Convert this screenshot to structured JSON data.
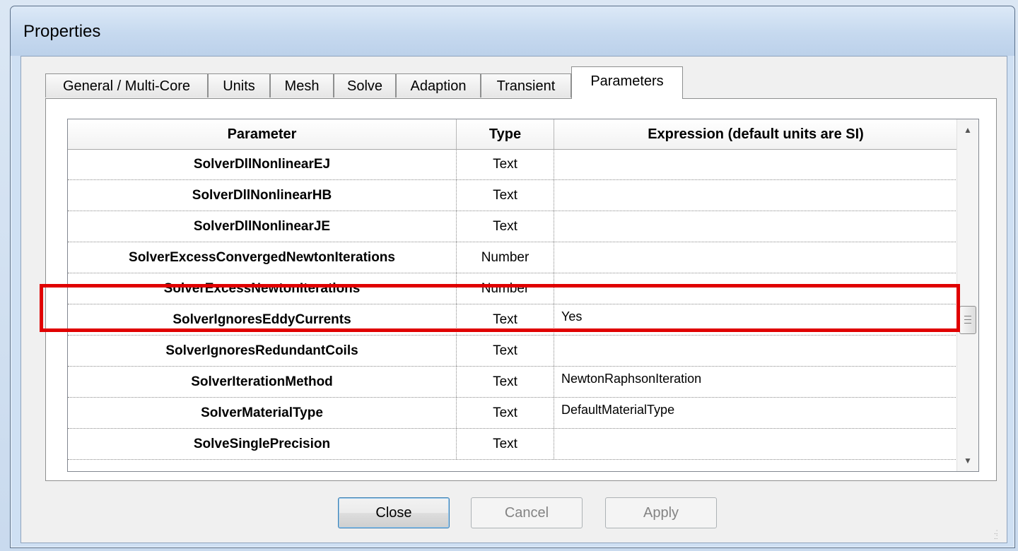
{
  "window": {
    "title": "Properties"
  },
  "tabs": [
    {
      "label": "General / Multi-Core"
    },
    {
      "label": "Units"
    },
    {
      "label": "Mesh"
    },
    {
      "label": "Solve"
    },
    {
      "label": "Adaption"
    },
    {
      "label": "Transient"
    },
    {
      "label": "Parameters",
      "active": true
    }
  ],
  "grid": {
    "headers": {
      "parameter": "Parameter",
      "type": "Type",
      "expression": "Expression (default units are SI)"
    },
    "rows": [
      {
        "parameter": "SolverDllNonlinearEJ",
        "type": "Text",
        "expression": ""
      },
      {
        "parameter": "SolverDllNonlinearHB",
        "type": "Text",
        "expression": ""
      },
      {
        "parameter": "SolverDllNonlinearJE",
        "type": "Text",
        "expression": ""
      },
      {
        "parameter": "SolverExcessConvergedNewtonIterations",
        "type": "Number",
        "expression": ""
      },
      {
        "parameter": "SolverExcessNewtonIterations",
        "type": "Number",
        "expression": ""
      },
      {
        "parameter": "SolverIgnoresEddyCurrents",
        "type": "Text",
        "expression": "Yes"
      },
      {
        "parameter": "SolverIgnoresRedundantCoils",
        "type": "Text",
        "expression": ""
      },
      {
        "parameter": "SolverIterationMethod",
        "type": "Text",
        "expression": "NewtonRaphsonIteration"
      },
      {
        "parameter": "SolverMaterialType",
        "type": "Text",
        "expression": "DefaultMaterialType"
      },
      {
        "parameter": "SolveSinglePrecision",
        "type": "Text",
        "expression": ""
      }
    ],
    "highlighted_row": "SolverIgnoresEddyCurrents",
    "highlight_color": "#e00000"
  },
  "buttons": {
    "close": "Close",
    "cancel": "Cancel",
    "apply": "Apply"
  }
}
